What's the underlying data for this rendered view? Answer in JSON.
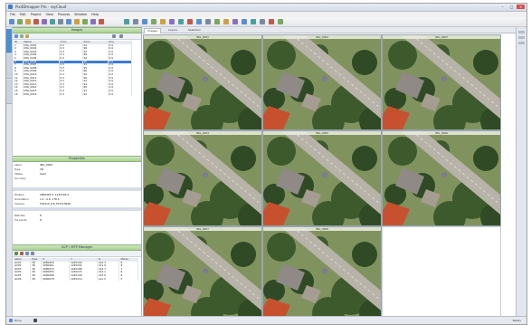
{
  "window": {
    "title": "Pix4Dmapper Pro - rayCloud"
  },
  "menu": [
    "File",
    "Edit",
    "Project",
    "View",
    "Process",
    "Window",
    "Help"
  ],
  "left_panel": {
    "images_header": "Images",
    "table_headers": [
      "ID",
      "Name",
      "Ymin",
      "Xmin",
      "Proj"
    ],
    "rows": [
      [
        "1",
        "IMG_0001",
        "0.3",
        "92",
        "0.9"
      ],
      [
        "2",
        "IMG_0002",
        "0.3",
        "96",
        "0.9"
      ],
      [
        "3",
        "IMG_0003",
        "0.3",
        "93",
        "0.9"
      ],
      [
        "4",
        "IMG_0004",
        "0.3",
        "89",
        "0.9"
      ],
      [
        "5",
        "IMG_0005",
        "0.3",
        "94",
        "0.9"
      ],
      [
        "6",
        "IMG_0006",
        "0.3",
        "90",
        "0.9"
      ],
      [
        "7",
        "IMG_0007",
        "0.3",
        "91",
        "0.9"
      ],
      [
        "8",
        "IMG_0008",
        "0.3",
        "95",
        "0.9"
      ],
      [
        "9",
        "IMG_0009",
        "0.3",
        "88",
        "0.9"
      ],
      [
        "10",
        "IMG_0010",
        "0.3",
        "92",
        "0.9"
      ],
      [
        "11",
        "IMG_0011",
        "0.3",
        "90",
        "0.9"
      ],
      [
        "12",
        "IMG_0012",
        "0.3",
        "93",
        "0.9"
      ],
      [
        "13",
        "IMG_0013",
        "0.3",
        "94",
        "0.9"
      ],
      [
        "14",
        "IMG_0014",
        "0.3",
        "89",
        "0.9"
      ],
      [
        "15",
        "IMG_0015",
        "0.3",
        "91",
        "0.9"
      ],
      [
        "16",
        "IMG_0016",
        "0.3",
        "92",
        "0.9"
      ]
    ],
    "selected_row": 5,
    "properties_header": "Properties",
    "properties": [
      [
        "Label",
        "IMG_0006"
      ],
      [
        "Type",
        "3D"
      ],
      [
        "Status",
        "Used"
      ],
      [
        "Accuracy",
        ""
      ]
    ],
    "position_rows": [
      [
        "Position",
        "2680450.3, 1245190.4"
      ],
      [
        "Orientation",
        "1.2, -0.8, 178.5"
      ],
      [
        "Camera",
        "FC6310_8.8_5472x3648"
      ]
    ],
    "params_rows": [
      [
        "Matches",
        "8"
      ],
      [
        "Tie points",
        "8"
      ]
    ],
    "gcp_header": "GCP / MTP Manager",
    "gcp_headers": [
      "Label",
      "Type",
      "X",
      "Y",
      "Z",
      "Marks"
    ],
    "gcp_rows": [
      [
        "GCP1",
        "3D",
        "2680450",
        "1245190",
        "412.3",
        "8"
      ],
      [
        "GCP2",
        "3D",
        "2680461",
        "1245204",
        "411.9",
        "8"
      ],
      [
        "GCP3",
        "3D",
        "2680472",
        "1245188",
        "412.7",
        "7"
      ],
      [
        "GCP4",
        "3D",
        "2680455",
        "1245215",
        "413.1",
        "6"
      ],
      [
        "GCP5",
        "3D",
        "2680468",
        "1245199",
        "412.0",
        "8"
      ],
      [
        "GCP6",
        "3D",
        "2680478",
        "1245210",
        "411.5",
        "5"
      ]
    ]
  },
  "viewer": {
    "tabs": [
      "Images",
      "Layers",
      "Selection"
    ],
    "active_tab": 0,
    "cells": [
      "IMG_0001",
      "IMG_0002",
      "IMG_0003",
      "IMG_0004",
      "IMG_0005",
      "IMG_0006",
      "IMG_0007",
      "IMG_0008"
    ]
  },
  "status": {
    "left": "Done",
    "right": "Ready"
  },
  "colors": {
    "accent": "#3a7bd5",
    "section_header": "#a8d190",
    "roof": "#c7512f",
    "road": "#b7b3a9",
    "tree": "#2f4a24"
  }
}
